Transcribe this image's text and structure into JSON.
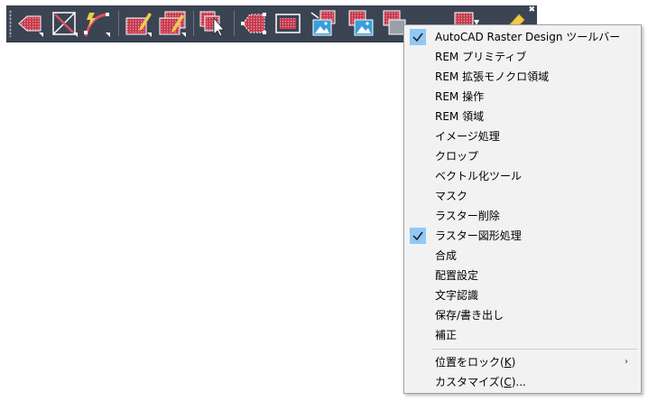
{
  "toolbar": {
    "close_glyph": "✖",
    "buttons": [
      {
        "name": "rem-region-icon"
      },
      {
        "name": "rem-line-delete-icon"
      },
      {
        "name": "rem-arc-lightning-icon"
      },
      {
        "name": "rem-edit-icon"
      },
      {
        "name": "rem-edit-multi-icon"
      },
      {
        "name": "select-cursor-icon"
      },
      {
        "name": "polygon-region-icon"
      },
      {
        "name": "rectangle-region-icon"
      },
      {
        "name": "image-insert-icon"
      },
      {
        "name": "image-layer-icon"
      },
      {
        "name": "layer-gray-icon"
      },
      {
        "name": "layer-export-icon"
      },
      {
        "name": "pencil-icon"
      }
    ]
  },
  "menu": {
    "items": [
      {
        "label": "AutoCAD Raster Design ツールバー",
        "checked": true
      },
      {
        "label": "REM プリミティブ",
        "checked": false
      },
      {
        "label": "REM 拡張モノクロ領域",
        "checked": false
      },
      {
        "label": "REM 操作",
        "checked": false
      },
      {
        "label": "REM 領域",
        "checked": false
      },
      {
        "label": "イメージ処理",
        "checked": false
      },
      {
        "label": "クロップ",
        "checked": false
      },
      {
        "label": "ベクトル化ツール",
        "checked": false
      },
      {
        "label": "マスク",
        "checked": false
      },
      {
        "label": "ラスター削除",
        "checked": false
      },
      {
        "label": "ラスター図形処理",
        "checked": true
      },
      {
        "label": "合成",
        "checked": false
      },
      {
        "label": "配置設定",
        "checked": false
      },
      {
        "label": "文字認識",
        "checked": false
      },
      {
        "label": "保存/書き出し",
        "checked": false
      },
      {
        "label": "補正",
        "checked": false
      }
    ],
    "lock": {
      "prefix": "位置をロック(",
      "key": "K",
      "suffix": ")",
      "arrow": "›"
    },
    "customize": {
      "prefix": "カスタマイズ(",
      "key": "C",
      "suffix": ")..."
    }
  }
}
